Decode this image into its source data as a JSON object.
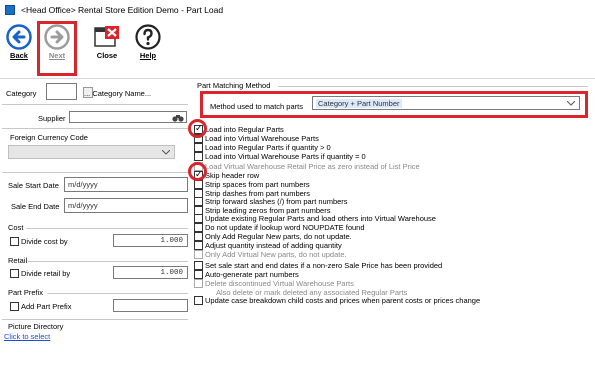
{
  "window": {
    "title": "<Head Office> Rental Store Edition Demo - Part Load"
  },
  "toolbar": {
    "back_label": "Back",
    "next_label": "Next",
    "close_label": "Close",
    "help_label": "Help"
  },
  "left": {
    "category_label": "Category",
    "category_value": "",
    "category_name_label": "... Category Name...",
    "supplier_label": "Supplier",
    "foreign_currency_label": "Foreign Currency Code",
    "sale_start_label": "Sale Start Date",
    "sale_start_placeholder": "m/d/yyyy",
    "sale_end_label": "Sale End Date",
    "sale_end_placeholder": "m/d/yyyy",
    "cost_heading": "Cost",
    "divide_cost_label": "Divide cost by",
    "divide_cost_value": "1.000",
    "retail_heading": "Retail",
    "divide_retail_label": "Divide retail by",
    "divide_retail_value": "1.000",
    "part_prefix_heading": "Part Prefix",
    "add_part_prefix_label": "Add Part Prefix",
    "picture_directory_heading": "Picture Directory",
    "click_to_select": "Click to select"
  },
  "right": {
    "group_title": "Part Matching Method",
    "method_label": "Method used to match parts",
    "method_value": "Category + Part Number",
    "options": [
      {
        "label": "Load into Regular Parts",
        "checked": true,
        "enabled": true
      },
      {
        "label": "Load into Virtual Warehouse Parts",
        "checked": false,
        "enabled": true
      },
      {
        "label": "Load into Regular Parts if quantity > 0",
        "checked": false,
        "enabled": true
      },
      {
        "label": "Load into Virtual Warehouse Parts if quantity = 0",
        "checked": false,
        "enabled": true
      },
      {
        "label": "Load Virtual Warehouse Retail Price as zero instead of List Price",
        "checked": false,
        "enabled": false
      },
      {
        "label": "Skip header row",
        "checked": true,
        "enabled": true
      },
      {
        "label": "Strip spaces from part numbers",
        "checked": false,
        "enabled": true
      },
      {
        "label": "Strip dashes from part numbers",
        "checked": false,
        "enabled": true
      },
      {
        "label": "Strip forward slashes (/) from part numbers",
        "checked": false,
        "enabled": true
      },
      {
        "label": "Strip leading zeros from part numbers",
        "checked": false,
        "enabled": true
      },
      {
        "label": "Update existing Regular Parts and load others into Virtual Warehouse",
        "checked": false,
        "enabled": true
      },
      {
        "label": "Do not update if lookup word NOUPDATE found",
        "checked": false,
        "enabled": true
      },
      {
        "label": "Only Add Regular New parts, do not update.",
        "checked": false,
        "enabled": true
      },
      {
        "label": "Adjust quantity instead of adding quantity",
        "checked": false,
        "enabled": true
      },
      {
        "label": "Only Add Virtual New parts, do not update.",
        "checked": false,
        "enabled": false
      },
      {
        "label": "Set sale start and end dates if a non-zero Sale Price has been provided",
        "checked": false,
        "enabled": true
      },
      {
        "label": "Auto-generate part numbers",
        "checked": false,
        "enabled": true
      },
      {
        "label": "Delete discontinued Virtual Warehouse Parts",
        "checked": false,
        "enabled": false
      },
      {
        "label": "Also delete or mark deleted any associated Regular Parts",
        "checked": false,
        "enabled": false
      },
      {
        "label": "Update case breakdown child costs and prices when parent costs or prices change",
        "checked": false,
        "enabled": true
      }
    ]
  },
  "colors": {
    "highlight": "#d8262c",
    "back_icon": "#1a63c6",
    "close_icon": "#e0202a"
  }
}
